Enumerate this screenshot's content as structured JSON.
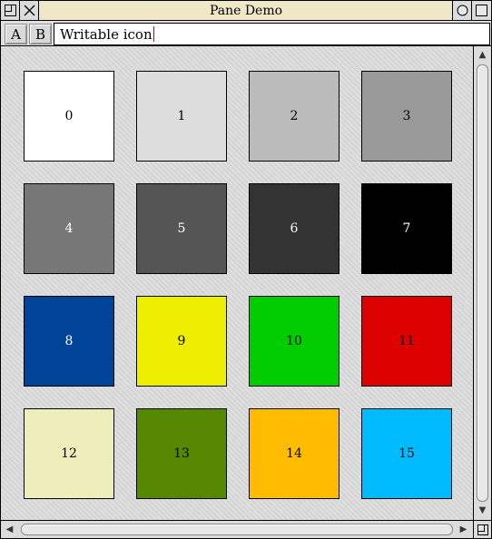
{
  "window": {
    "title": "Pane Demo",
    "icons": [
      "back-icon",
      "close-icon",
      "iconise-icon",
      "toggle-size-icon"
    ]
  },
  "toolbar": {
    "button_a_label": "A",
    "button_b_label": "B",
    "writable_value": "Writable icon"
  },
  "swatches": [
    {
      "label": "0",
      "color": "#ffffff",
      "text_color": "#000000"
    },
    {
      "label": "1",
      "color": "#dddddd",
      "text_color": "#000000"
    },
    {
      "label": "2",
      "color": "#bbbbbb",
      "text_color": "#000000"
    },
    {
      "label": "3",
      "color": "#999999",
      "text_color": "#000000"
    },
    {
      "label": "4",
      "color": "#777777",
      "text_color": "#ffffff"
    },
    {
      "label": "5",
      "color": "#555555",
      "text_color": "#ffffff"
    },
    {
      "label": "6",
      "color": "#333333",
      "text_color": "#ffffff"
    },
    {
      "label": "7",
      "color": "#000000",
      "text_color": "#ffffff"
    },
    {
      "label": "8",
      "color": "#004499",
      "text_color": "#ffffff"
    },
    {
      "label": "9",
      "color": "#eeee00",
      "text_color": "#000000"
    },
    {
      "label": "10",
      "color": "#00cc00",
      "text_color": "#000000"
    },
    {
      "label": "11",
      "color": "#dd0000",
      "text_color": "#000000"
    },
    {
      "label": "12",
      "color": "#eeeebb",
      "text_color": "#000000"
    },
    {
      "label": "13",
      "color": "#558800",
      "text_color": "#000000"
    },
    {
      "label": "14",
      "color": "#ffbb00",
      "text_color": "#000000"
    },
    {
      "label": "15",
      "color": "#00bbff",
      "text_color": "#000000"
    }
  ],
  "scrollbars": {
    "vertical_icons": [
      "scroll-up-arrow-icon",
      "scroll-down-arrow-icon"
    ],
    "horizontal_icons": [
      "scroll-left-arrow-icon",
      "scroll-right-arrow-icon"
    ],
    "corner_icon": "resize-icon"
  }
}
